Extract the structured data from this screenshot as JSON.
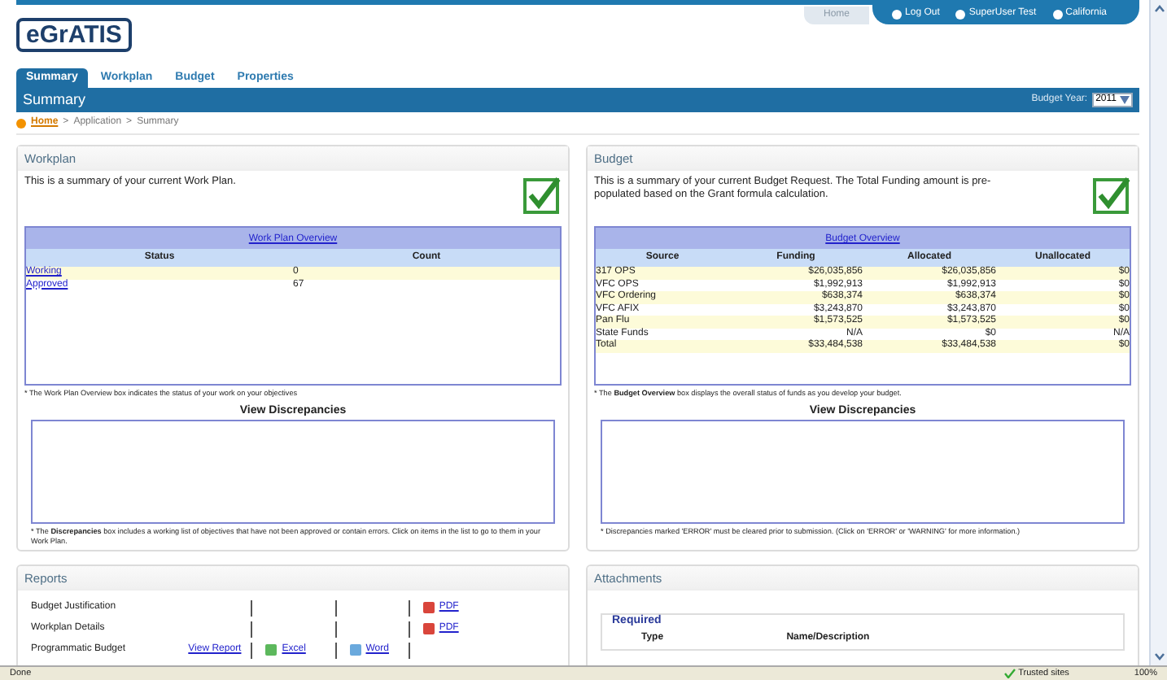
{
  "header": {
    "logo": "eGrATIS",
    "home": "Home",
    "links": [
      "Log Out",
      "SuperUser Test",
      "California"
    ]
  },
  "tabs": [
    {
      "label": "Summary",
      "selected": true
    },
    {
      "label": "Workplan",
      "selected": false
    },
    {
      "label": "Budget",
      "selected": false
    },
    {
      "label": "Properties",
      "selected": false
    }
  ],
  "title_bar": {
    "title": "Summary",
    "budget_year_label": "Budget Year:",
    "budget_year": "2011"
  },
  "breadcrumb": {
    "items": [
      "Home",
      "Application",
      "Summary"
    ],
    "separator": ">"
  },
  "workplan": {
    "title": "Workplan",
    "description": "This is a summary of your current Work Plan.",
    "complete": true,
    "overview_title": "Work Plan Overview",
    "columns": [
      "Status",
      "Count"
    ],
    "rows": [
      {
        "status": "Working",
        "count": "0"
      },
      {
        "status": "Approved",
        "count": "67"
      }
    ],
    "note": "* The Work Plan Overview box indicates the status of your work on your objectives",
    "discrepancies_title": "View Discrepancies",
    "discrepancies_note": "* The **Discrepancies** box includes a working list of objectives that have not been approved or contain errors. Click on items in the list to go to them in your Work Plan."
  },
  "budget": {
    "title": "Budget",
    "description": "This is a summary of your current Budget Request. The Total Funding amount is pre-populated based on the Grant formula calculation.",
    "complete": true,
    "overview_title": "Budget Overview",
    "columns": [
      "Source",
      "Funding",
      "Allocated",
      "Unallocated"
    ],
    "rows": [
      {
        "source": "317 OPS",
        "funding": "$26,035,856",
        "allocated": "$26,035,856",
        "unallocated": "$0"
      },
      {
        "source": "VFC OPS",
        "funding": "$1,992,913",
        "allocated": "$1,992,913",
        "unallocated": "$0"
      },
      {
        "source": "VFC Ordering",
        "funding": "$638,374",
        "allocated": "$638,374",
        "unallocated": "$0"
      },
      {
        "source": "VFC AFIX",
        "funding": "$3,243,870",
        "allocated": "$3,243,870",
        "unallocated": "$0"
      },
      {
        "source": "Pan Flu",
        "funding": "$1,573,525",
        "allocated": "$1,573,525",
        "unallocated": "$0"
      },
      {
        "source": "State Funds",
        "funding": "N/A",
        "allocated": "$0",
        "unallocated": "N/A"
      },
      {
        "source": "Total",
        "funding": "$33,484,538",
        "allocated": "$33,484,538",
        "unallocated": "$0"
      }
    ],
    "note": "* The **Budget Overview** box displays the overall status of funds as you develop your budget.",
    "discrepancies_title": "View Discrepancies",
    "discrepancies_note": "* Discrepancies marked 'ERROR' must be cleared prior to submission. (Click on 'ERROR' or 'WARNING' for more information.)"
  },
  "reports": {
    "title": "Reports",
    "rows": [
      {
        "name": "Budget Justification",
        "pdf": "PDF"
      },
      {
        "name": "Workplan Details",
        "pdf": "PDF"
      },
      {
        "name": "Programmatic Budget",
        "view": "View Report",
        "excel": "Excel",
        "word": "Word"
      }
    ]
  },
  "attachments": {
    "title": "Attachments",
    "legend": "Required",
    "columns": [
      "Type",
      "Name/Description"
    ]
  },
  "status_bar": {
    "text": "Done",
    "zone": "Trusted sites",
    "zoom": "100%"
  }
}
